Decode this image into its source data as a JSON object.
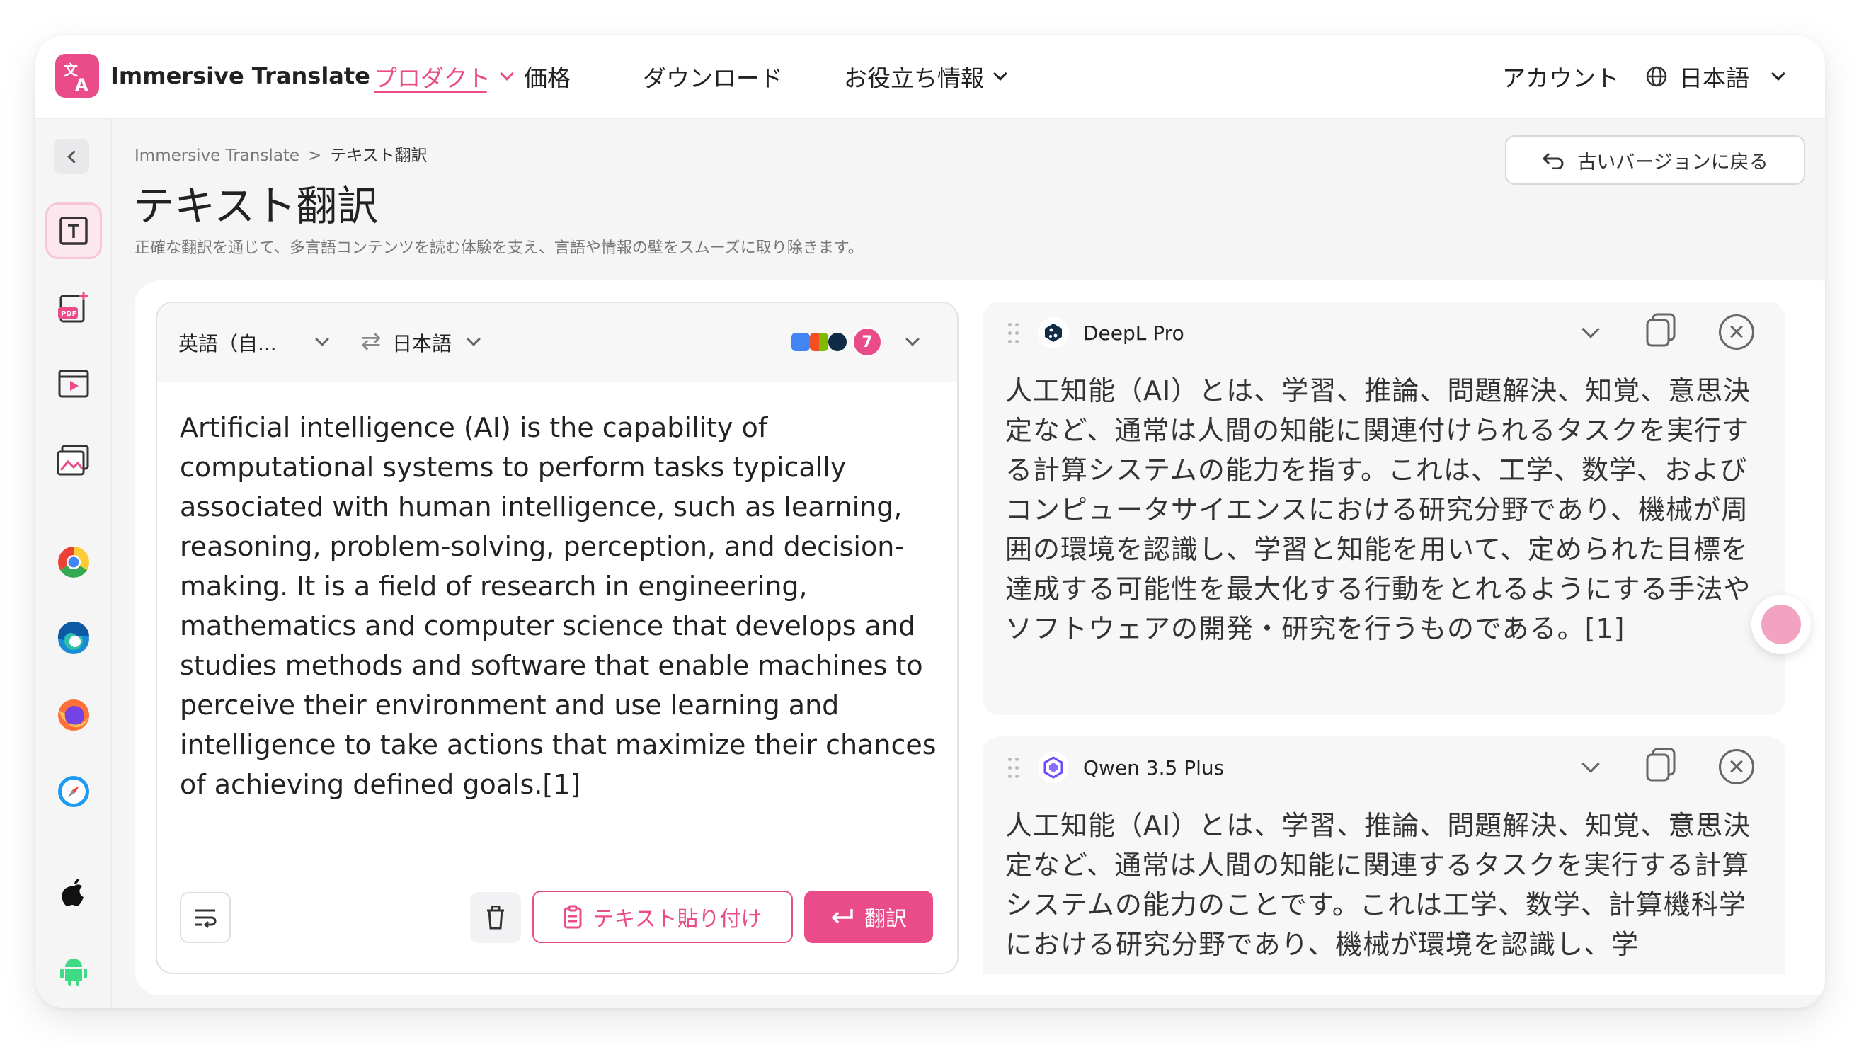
{
  "brand": {
    "name": "Immersive Translate",
    "accent": "#ea4c89"
  },
  "nav": {
    "items": [
      {
        "label": "プロダクト",
        "has_dropdown": true,
        "active": true
      },
      {
        "label": "価格",
        "has_dropdown": false
      },
      {
        "label": "ダウンロード",
        "has_dropdown": false
      },
      {
        "label": "お役立ち情報",
        "has_dropdown": true
      }
    ],
    "account": "アカウント",
    "language": "日本語"
  },
  "sidebar": {
    "items": [
      {
        "name": "text-translate",
        "icon": "text-t-icon",
        "active": true
      },
      {
        "name": "pdf-translate",
        "icon": "pdf-icon"
      },
      {
        "name": "video-translate",
        "icon": "video-icon"
      },
      {
        "name": "image-translate",
        "icon": "image-icon"
      },
      {
        "name": "chrome",
        "icon": "chrome-icon"
      },
      {
        "name": "edge",
        "icon": "edge-icon"
      },
      {
        "name": "firefox",
        "icon": "firefox-icon"
      },
      {
        "name": "safari",
        "icon": "safari-icon"
      },
      {
        "name": "apple",
        "icon": "apple-icon"
      },
      {
        "name": "android",
        "icon": "android-icon"
      }
    ]
  },
  "page": {
    "breadcrumb": [
      "Immersive Translate",
      "テキスト翻訳"
    ],
    "breadcrumb_sep": ">",
    "title": "テキスト翻訳",
    "subtitle": "正確な翻訳を通じて、多言語コンテンツを読む体験を支え、言語や情報の壁をスムーズに取り除きます。",
    "old_version_button": "古いバージョンに戻る"
  },
  "source": {
    "source_lang": "英語（自...",
    "target_lang": "日本語",
    "engine_count": "7",
    "text": "Artificial intelligence (AI) is the capability of computational systems to perform tasks typically associated with human intelligence, such as learning, reasoning, problem-solving, perception, and decision-making. It is a field of research in engineering, mathematics and computer science that develops and studies methods and software that enable machines to perceive their environment and use learning and intelligence to take actions that maximize their chances of achieving defined goals.[1]",
    "paste_label": "テキスト貼り付け",
    "translate_label": "翻訳"
  },
  "results": [
    {
      "engine": "DeepL Pro",
      "icon": "deepl-icon",
      "text": "人工知能（AI）とは、学習、推論、問題解決、知覚、意思決定など、通常は人間の知能に関連付けられるタスクを実行する計算システムの能力を指す。これは、工学、数学、およびコンピュータサイエンスにおける研究分野であり、機械が周囲の環境を認識し、学習と知能を用いて、定められた目標を達成する可能性を最大化する行動をとれるようにする手法やソフトウェアの開発・研究を行うものである。[1]"
    },
    {
      "engine": "Qwen 3.5 Plus",
      "icon": "qwen-icon",
      "text": "人工知能（AI）とは、学習、推論、問題解決、知覚、意思決定など、通常は人間の知能に関連するタスクを実行する計算システムの能力のことです。これは工学、数学、計算機科学における研究分野であり、機械が環境を認識し、学"
    }
  ]
}
